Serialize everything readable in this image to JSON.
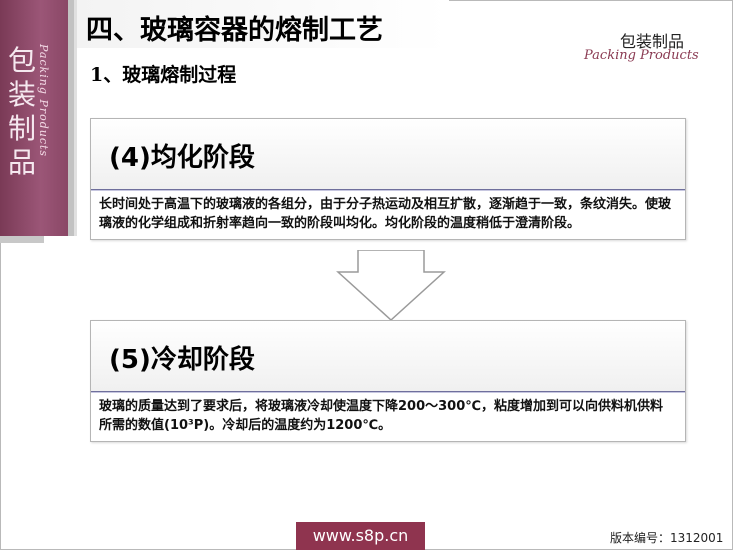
{
  "header": {
    "title": "四、玻璃容器的熔制工艺",
    "subtitle": "1、玻璃熔制过程"
  },
  "side_label": {
    "chars": [
      "包",
      "装",
      "制",
      "品"
    ],
    "script": "Packing Products"
  },
  "logo": {
    "cn": "包装制品",
    "en": "Packing Products"
  },
  "stages": [
    {
      "title": "(4)均化阶段",
      "body": "长时间处于高温下的玻璃液的各组分，由于分子热运动及相互扩散，逐渐趋于一致，条纹消失。使玻璃液的化学组成和折射率趋向一致的阶段叫均化。均化阶段的温度稍低于澄清阶段。"
    },
    {
      "title": "(5)冷却阶段",
      "body": "玻璃的质量达到了要求后，将玻璃液冷却使温度下降200～300℃，粘度增加到可以向供料机供料所需的数值(10³P)。冷却后的温度约为1200℃。"
    }
  ],
  "footer": {
    "url": "www.s8p.cn",
    "version": "版本编号：1312001"
  },
  "colors": {
    "brand": "#8f344f",
    "side_band": "#9b5677"
  },
  "icons": {
    "flow_arrow": "down-arrow-icon"
  }
}
